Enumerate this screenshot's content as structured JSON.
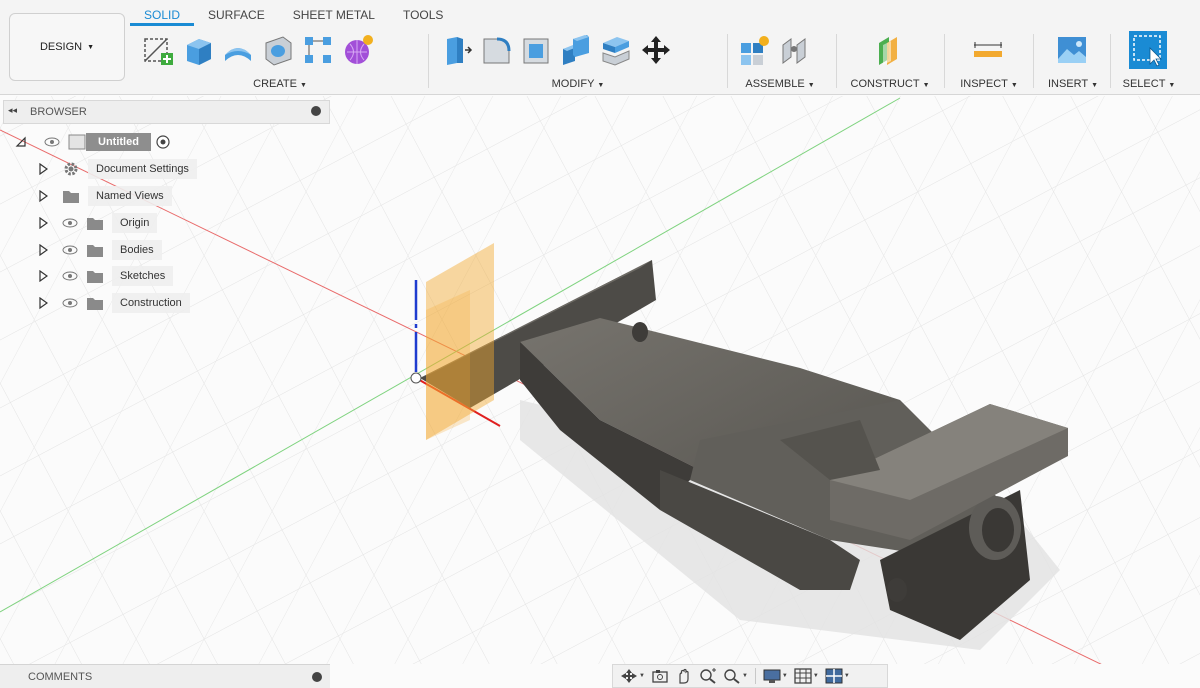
{
  "tabs": [
    {
      "label": "SOLID",
      "active": true
    },
    {
      "label": "SURFACE",
      "active": false
    },
    {
      "label": "SHEET METAL",
      "active": false
    },
    {
      "label": "TOOLS",
      "active": false
    }
  ],
  "workspace": {
    "label": "DESIGN"
  },
  "groups": {
    "create": {
      "label": "CREATE",
      "icons": [
        "create-sketch-icon",
        "extrude-icon",
        "revolve-icon",
        "hole-icon",
        "rectangular-pattern-icon",
        "create-form-icon"
      ]
    },
    "modify": {
      "label": "MODIFY",
      "icons": [
        "press-pull-icon",
        "fillet-icon",
        "shell-icon",
        "combine-icon",
        "split-body-icon",
        "move-copy-icon"
      ]
    },
    "assemble": {
      "label": "ASSEMBLE",
      "icons": [
        "new-component-icon",
        "joint-icon"
      ]
    },
    "construct": {
      "label": "CONSTRUCT",
      "icons": [
        "offset-plane-icon"
      ]
    },
    "inspect": {
      "label": "INSPECT",
      "icons": [
        "measure-icon"
      ]
    },
    "insert": {
      "label": "INSERT",
      "icons": [
        "insert-image-icon"
      ]
    },
    "select": {
      "label": "SELECT",
      "icons": [
        "select-icon"
      ]
    }
  },
  "browser": {
    "title": "BROWSER",
    "root": {
      "label": "Untitled"
    },
    "items": [
      {
        "label": "Document Settings",
        "icon": "gear-icon",
        "visible_toggle": false
      },
      {
        "label": "Named Views",
        "icon": "folder-icon",
        "visible_toggle": false
      },
      {
        "label": "Origin",
        "icon": "folder-icon",
        "visible_toggle": true
      },
      {
        "label": "Bodies",
        "icon": "folder-icon",
        "visible_toggle": true
      },
      {
        "label": "Sketches",
        "icon": "folder-icon",
        "visible_toggle": true
      },
      {
        "label": "Construction",
        "icon": "folder-icon",
        "visible_toggle": true
      }
    ]
  },
  "comments": {
    "title": "COMMENTS"
  },
  "navbar": {
    "icons": [
      "orbit-icon",
      "look-at-icon",
      "pan-icon",
      "zoom-icon",
      "zoom-window-icon",
      "display-settings-icon",
      "grid-settings-icon",
      "viewports-icon"
    ]
  },
  "colors": {
    "accent": "#1a8bd4",
    "x_axis": "#e23a3a",
    "y_axis": "#3cbf3c",
    "z_axis": "#1f3ccf",
    "plane": "#f2a92f",
    "body": "#5b5954"
  }
}
